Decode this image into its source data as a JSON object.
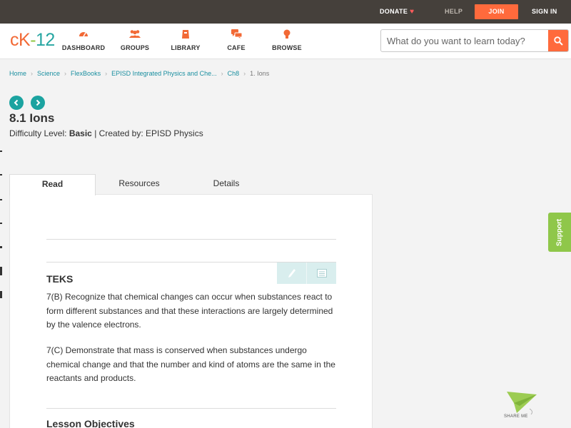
{
  "topbar": {
    "donate": "DONATE",
    "help": "HELP",
    "join": "JOIN",
    "signin": "SIGN IN"
  },
  "logo": {
    "ck": "cK",
    "dash": "-",
    "num": "12"
  },
  "nav": {
    "dashboard": "DASHBOARD",
    "groups": "GROUPS",
    "library": "LIBRARY",
    "cafe": "CAFE",
    "browse": "BROWSE"
  },
  "search": {
    "placeholder": "What do you want to learn today?"
  },
  "breadcrumb": [
    "Home",
    "Science",
    "FlexBooks",
    "EPISD Integrated Physics and Che...",
    "Ch8",
    "1. Ions"
  ],
  "page": {
    "title": "8.1 Ions",
    "difficulty_label": "Difficulty Level:",
    "difficulty_value": "Basic",
    "created_by": "| Created by: EPISD Physics"
  },
  "tabs": {
    "read": "Read",
    "resources": "Resources",
    "details": "Details"
  },
  "content": {
    "teks_heading": "TEKS",
    "para1": "7(B) Recognize that chemical changes can occur when substances react to form different substances and that these interactions are largely determined by the valence electrons.",
    "para2": "7(C) Demonstrate that mass is conserved when substances undergo chemical change and that the number and kind of atoms are the same in the reactants and products.",
    "lesson_heading": "Lesson Objectives"
  },
  "support": "Support",
  "shareme": "SHARE ME",
  "colors": {
    "accent": "#f26935",
    "teal": "#1ba3a0",
    "green": "#8fc74a",
    "topbar": "#45403b"
  }
}
